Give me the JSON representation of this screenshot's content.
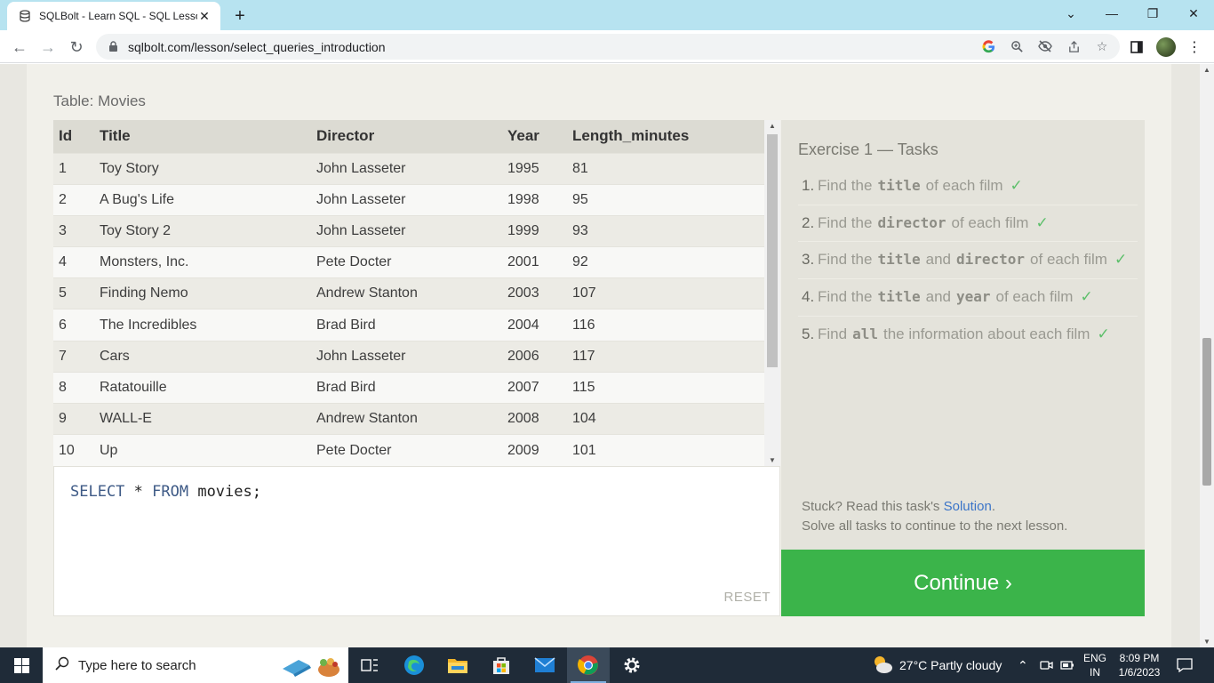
{
  "browser": {
    "tab_title": "SQLBolt - Learn SQL - SQL Lesson",
    "url": "sqlbolt.com/lesson/select_queries_introduction"
  },
  "page": {
    "table_caption": "Table: Movies",
    "table": {
      "columns": [
        "Id",
        "Title",
        "Director",
        "Year",
        "Length_minutes"
      ],
      "rows": [
        [
          "1",
          "Toy Story",
          "John Lasseter",
          "1995",
          "81"
        ],
        [
          "2",
          "A Bug's Life",
          "John Lasseter",
          "1998",
          "95"
        ],
        [
          "3",
          "Toy Story 2",
          "John Lasseter",
          "1999",
          "93"
        ],
        [
          "4",
          "Monsters, Inc.",
          "Pete Docter",
          "2001",
          "92"
        ],
        [
          "5",
          "Finding Nemo",
          "Andrew Stanton",
          "2003",
          "107"
        ],
        [
          "6",
          "The Incredibles",
          "Brad Bird",
          "2004",
          "116"
        ],
        [
          "7",
          "Cars",
          "John Lasseter",
          "2006",
          "117"
        ],
        [
          "8",
          "Ratatouille",
          "Brad Bird",
          "2007",
          "115"
        ],
        [
          "9",
          "WALL-E",
          "Andrew Stanton",
          "2008",
          "104"
        ],
        [
          "10",
          "Up",
          "Pete Docter",
          "2009",
          "101"
        ]
      ]
    },
    "editor": {
      "kw_select": "SELECT",
      "star": " * ",
      "kw_from": "FROM",
      "rest": " movies;",
      "reset_label": "RESET"
    },
    "exercise": {
      "title": "Exercise 1 — Tasks",
      "tasks": [
        {
          "num": "1.",
          "parts": [
            "Find the",
            "title",
            "of each film"
          ]
        },
        {
          "num": "2.",
          "parts": [
            "Find the",
            "director",
            "of each film"
          ]
        },
        {
          "num": "3.",
          "parts": [
            "Find the",
            "title",
            "and",
            "director",
            "of each film"
          ]
        },
        {
          "num": "4.",
          "parts": [
            "Find the",
            "title",
            "and",
            "year",
            "of each film"
          ]
        },
        {
          "num": "5.",
          "parts": [
            "Find",
            "all",
            "the information about each film"
          ]
        }
      ],
      "check": "✓",
      "stuck_prefix": "Stuck? Read this task's ",
      "solution_link": "Solution",
      "stuck_suffix": ".",
      "solve_all": "Solve all tasks to continue to the next lesson.",
      "continue_label": "Continue ›"
    }
  },
  "taskbar": {
    "search_placeholder": "Type here to search",
    "weather": "27°C  Partly cloudy",
    "lang_top": "ENG",
    "lang_bottom": "IN",
    "time": "8:09 PM",
    "date": "1/6/2023"
  },
  "colors": {
    "continue_green": "#3bb44a",
    "link_blue": "#3a74c8",
    "check_green": "#5cbf6a"
  }
}
